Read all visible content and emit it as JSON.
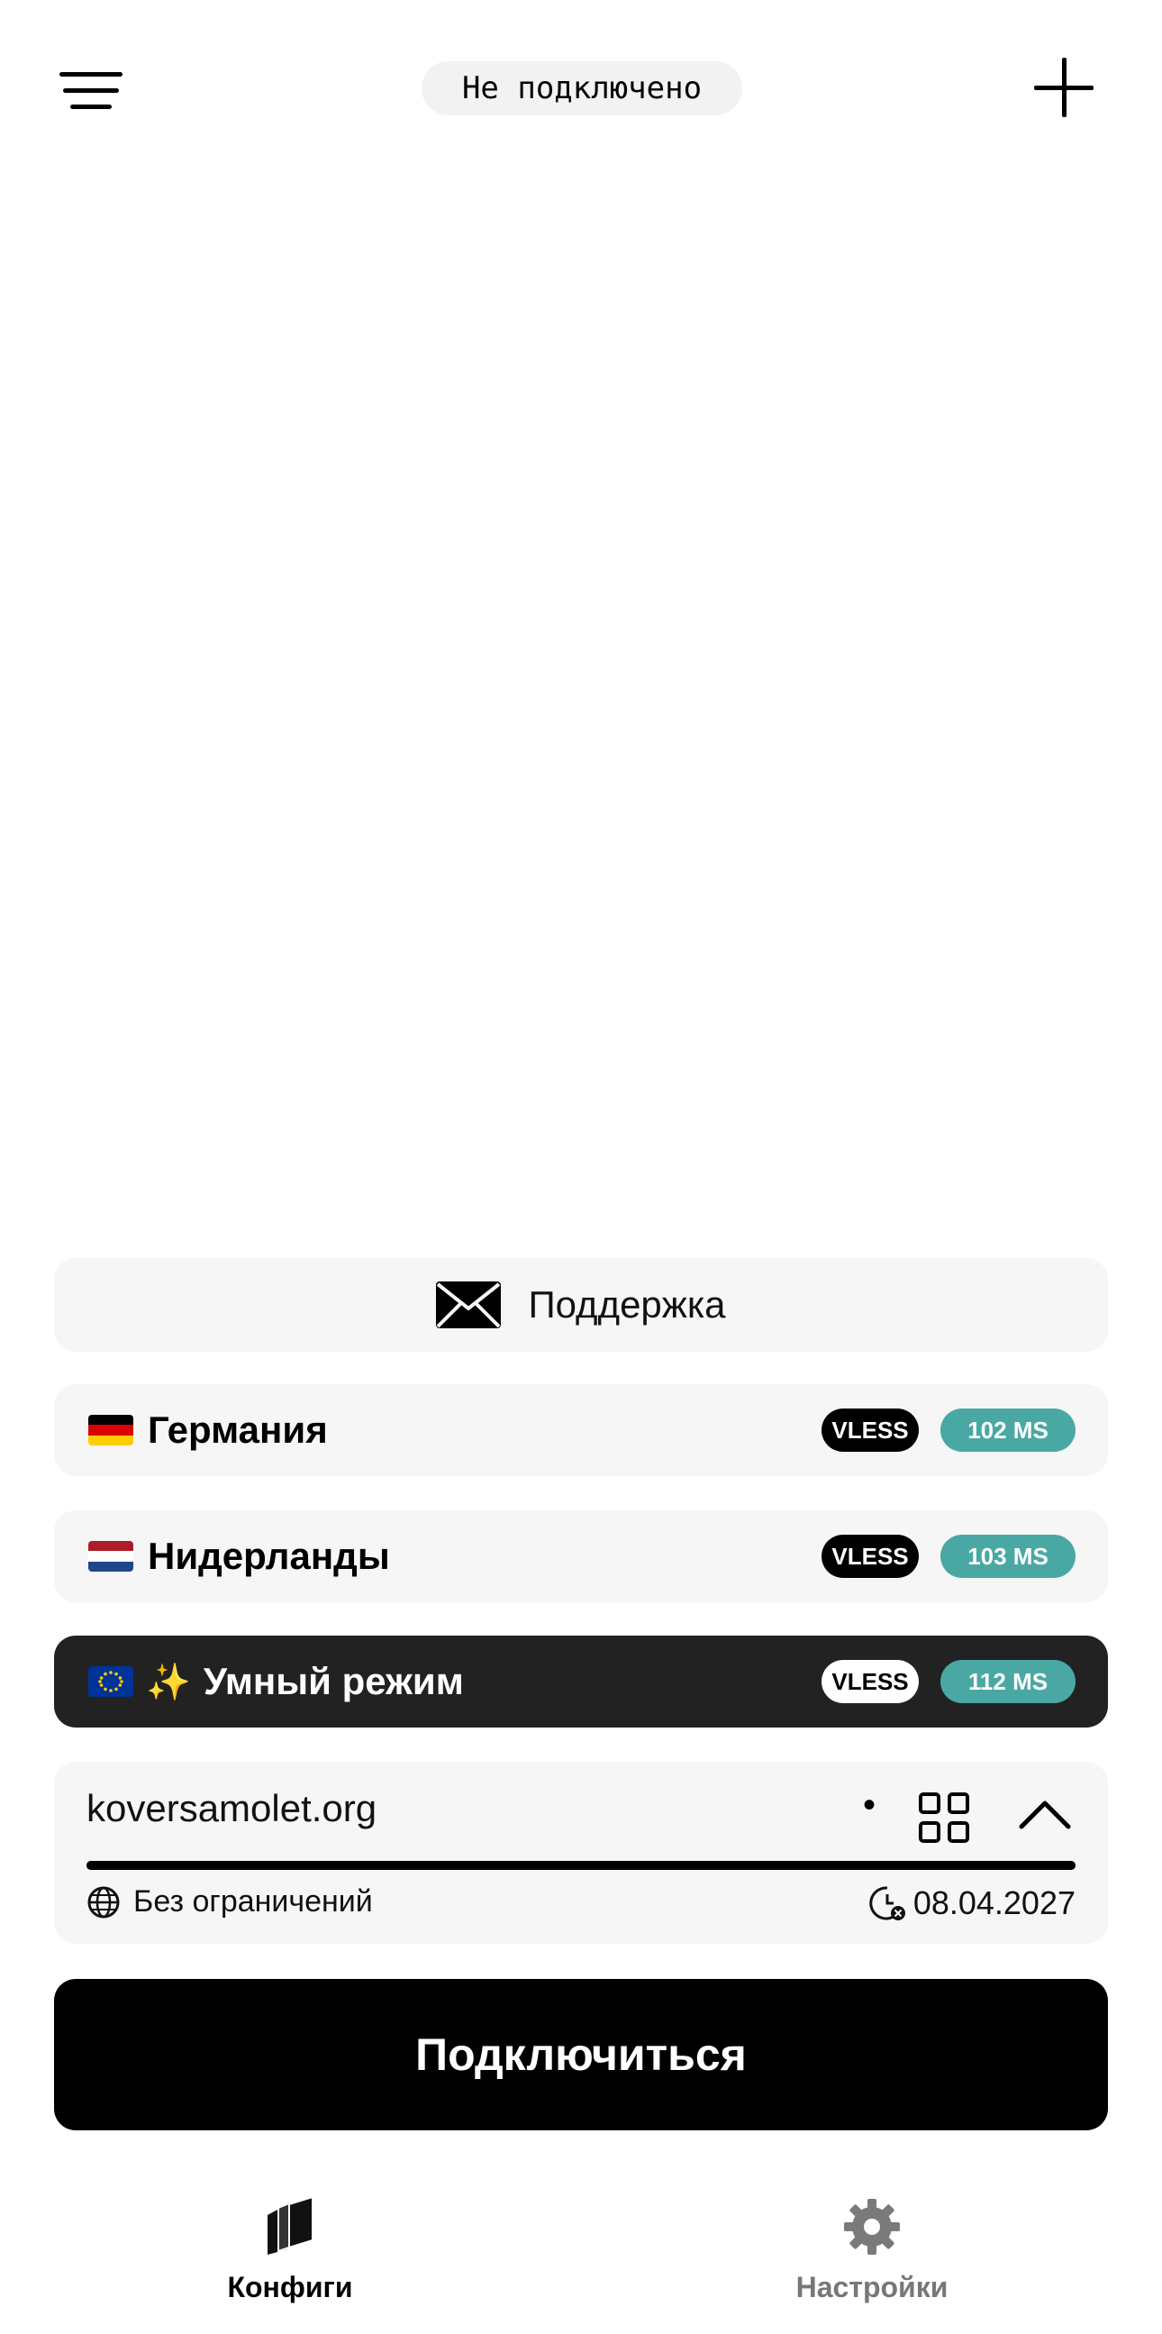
{
  "header": {
    "menu_icon": "hamburger-icon",
    "status": "Не подключено",
    "add_icon": "plus-icon"
  },
  "support": {
    "icon": "envelope-icon",
    "label": "Поддержка"
  },
  "servers": [
    {
      "flag": "de",
      "name": "Германия",
      "protocol": "VLESS",
      "ping": "102 MS",
      "active": false
    },
    {
      "flag": "nl",
      "name": "Нидерланды",
      "protocol": "VLESS",
      "ping": "103 MS",
      "active": false
    },
    {
      "flag": "eu",
      "sparkle": "✨",
      "name": "Умный режим",
      "protocol": "VLESS",
      "ping": "112 MS",
      "active": true
    }
  ],
  "subscription": {
    "domain": "koversamolet.org",
    "dot": "•",
    "traffic_label": "Без ограничений",
    "expiry": "08.04.2027",
    "progress": 1.0
  },
  "connect_label": "Подключиться",
  "nav": {
    "configs_label": "Конфиги",
    "settings_label": "Настройки"
  },
  "colors": {
    "ping_badge": "#4aa8a4",
    "active_card": "#222222",
    "card_bg": "#f6f6f6"
  }
}
